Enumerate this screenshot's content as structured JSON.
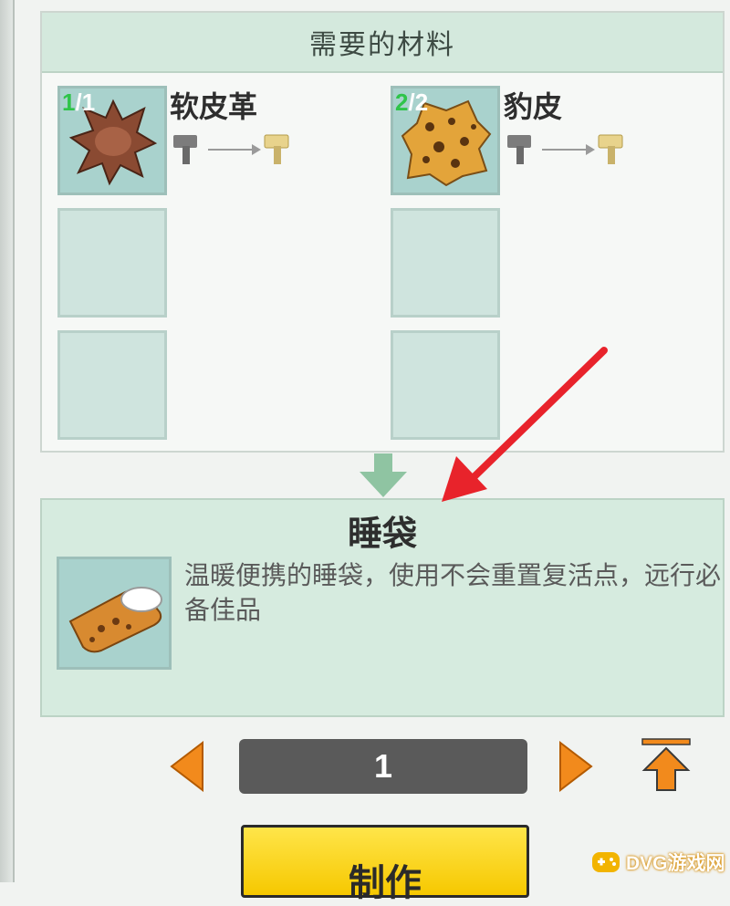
{
  "materials": {
    "title": "需要的材料",
    "items": [
      {
        "name": "软皮革",
        "have": "1",
        "need": "/1",
        "icon": "soft-leather-icon"
      },
      {
        "name": "豹皮",
        "have": "2",
        "need": "/2",
        "icon": "leopard-skin-icon"
      }
    ],
    "empty_slots": 4
  },
  "result": {
    "name": "睡袋",
    "description": "温暖便携的睡袋，使用不会重置复活点，远行必备佳品",
    "icon": "sleeping-bag-icon"
  },
  "quantity": {
    "value": "1"
  },
  "make_button": {
    "label": "制作"
  },
  "watermark": {
    "text": "DVG游戏网"
  },
  "colors": {
    "panel": "#d4e9dd",
    "slot": "#a9d2cd",
    "accent_orange": "#f28a1c",
    "make_yellow": "#f6c800",
    "annotation_red": "#e8232b"
  }
}
